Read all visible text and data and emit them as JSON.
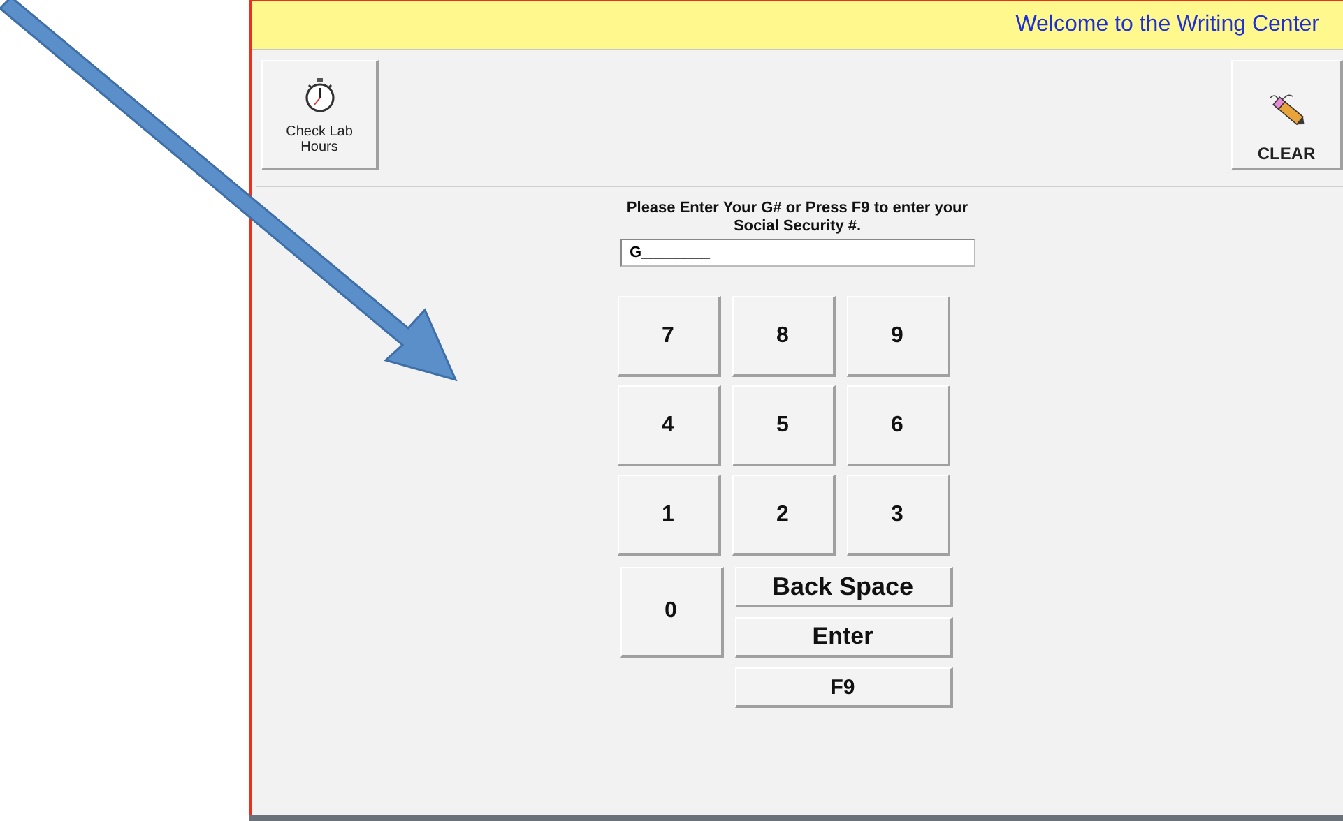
{
  "window": {
    "title": "Welcome to the Writing Center"
  },
  "toolbar": {
    "left_button": "Check Lab Hours",
    "right_button": "CLEAR"
  },
  "prompt": "Please Enter Your G# or Press F9 to enter your Social Security #.",
  "id_field": {
    "value": "G________"
  },
  "keypad": {
    "digit_keys": [
      "7",
      "8",
      "9",
      "4",
      "5",
      "6",
      "1",
      "2",
      "3"
    ],
    "zero_key": "0",
    "wide_keys": [
      "Back Space",
      "Enter",
      "F9"
    ]
  }
}
